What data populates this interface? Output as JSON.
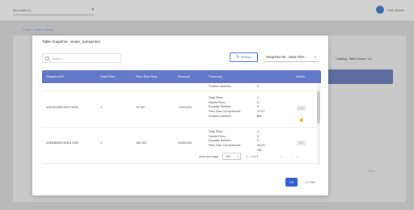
{
  "app": {
    "selector_label": "tpla platform",
    "user_name": "TNA, Admin"
  },
  "breadcrumb": "Home  >  Data Catalog",
  "background": {
    "filter_label": "Catalog, Table Name, La...",
    "pagination": "1 of 1"
  },
  "modal": {
    "title": "Table Snapshot - exam_transaction",
    "search_placeholder": "Search",
    "refresh_label": "Refresh",
    "snapshot_select": "Snapshot ID , Data Files ...",
    "columns": [
      "Snapshot ID",
      "Data Files",
      "Files Size Raw",
      "Records",
      "Summary",
      "Action"
    ],
    "row0": {
      "summary": [
        {
          "label": "Position Deletes:",
          "value": "0"
        }
      ]
    },
    "row1": {
      "snapshot_id": "4291902809157073000",
      "data_files": "1",
      "files_size_raw": "75 GB",
      "records": "7,003,000",
      "summary": [
        {
          "label": "Data Files:",
          "value": "1"
        },
        {
          "label": "Delete Files:",
          "value": "0"
        },
        {
          "label": "Equality Deletes:",
          "value": "0"
        },
        {
          "label": "Files Size Compressed:",
          "value": "21.97 GB"
        },
        {
          "label": "Position Deletes:",
          "value": "0"
        }
      ],
      "action": "OK"
    },
    "row2": {
      "snapshot_id": "2245960007491017000",
      "data_files": "1",
      "files_size_raw": "100 GB",
      "records": "9,005,000",
      "summary": [
        {
          "label": "Data Files:",
          "value": "1"
        },
        {
          "label": "Delete Files:",
          "value": "0"
        },
        {
          "label": "Equality Deletes:",
          "value": "0"
        },
        {
          "label": "Files Size Compressed:",
          "value": "29.29 GB"
        }
      ],
      "action": "OK"
    },
    "pagination": {
      "items_per_page_label": "Items per page:",
      "page_size": "100",
      "range": "1 – 3 of 3"
    },
    "ok_label": "OK",
    "close_label": "CLOSE"
  }
}
